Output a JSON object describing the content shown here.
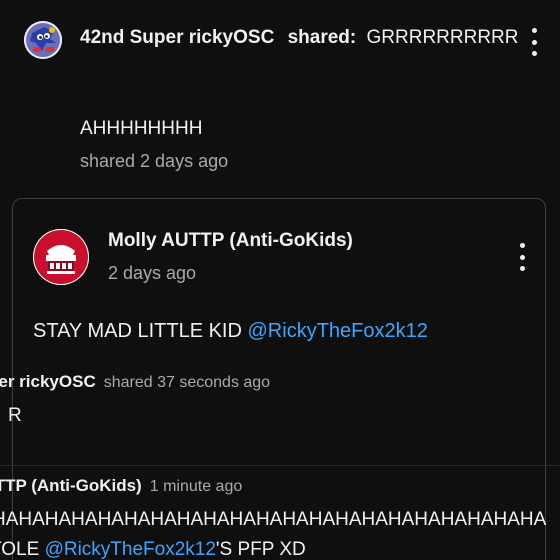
{
  "top_post": {
    "author": "42nd Super rickyOSC",
    "shared_label": "shared:",
    "shared_title": "GRRRRRRRRRR",
    "body": "AHHHHHHHH",
    "meta": "shared 2 days ago",
    "avatar_icon": "sonic-avatar-icon",
    "menu_icon": "more-vert-icon"
  },
  "shared_card": {
    "author": "Molly AUTTP (Anti-GoKids)",
    "time": "2 days ago",
    "message_prefix": "STAY MAD LITTLE KID ",
    "message_mention": "@RickyTheFox2k12",
    "avatar_icon": "red-hat-avatar-icon",
    "menu_icon": "more-vert-icon"
  },
  "nested_1": {
    "author": "per rickyOSC",
    "meta": "shared 37 seconds ago",
    "body": "R"
  },
  "nested_2": {
    "author": "ITTP (Anti-GoKids)",
    "meta": "1 minute ago",
    "body": "HAHAHAHAHAHAHAHAHAHAHAHAHAHAHAHAHAHAHAHAHA",
    "line3_prefix": "TOLE ",
    "line3_mention": "@RickyTheFox2k12",
    "line3_suffix": "'S PFP XD"
  },
  "colors": {
    "background": "#0f0f0f",
    "text": "#f1f1f1",
    "secondary_text": "#aaaaaa",
    "link": "#3ea6ff",
    "card_border": "#3f3f3f"
  }
}
